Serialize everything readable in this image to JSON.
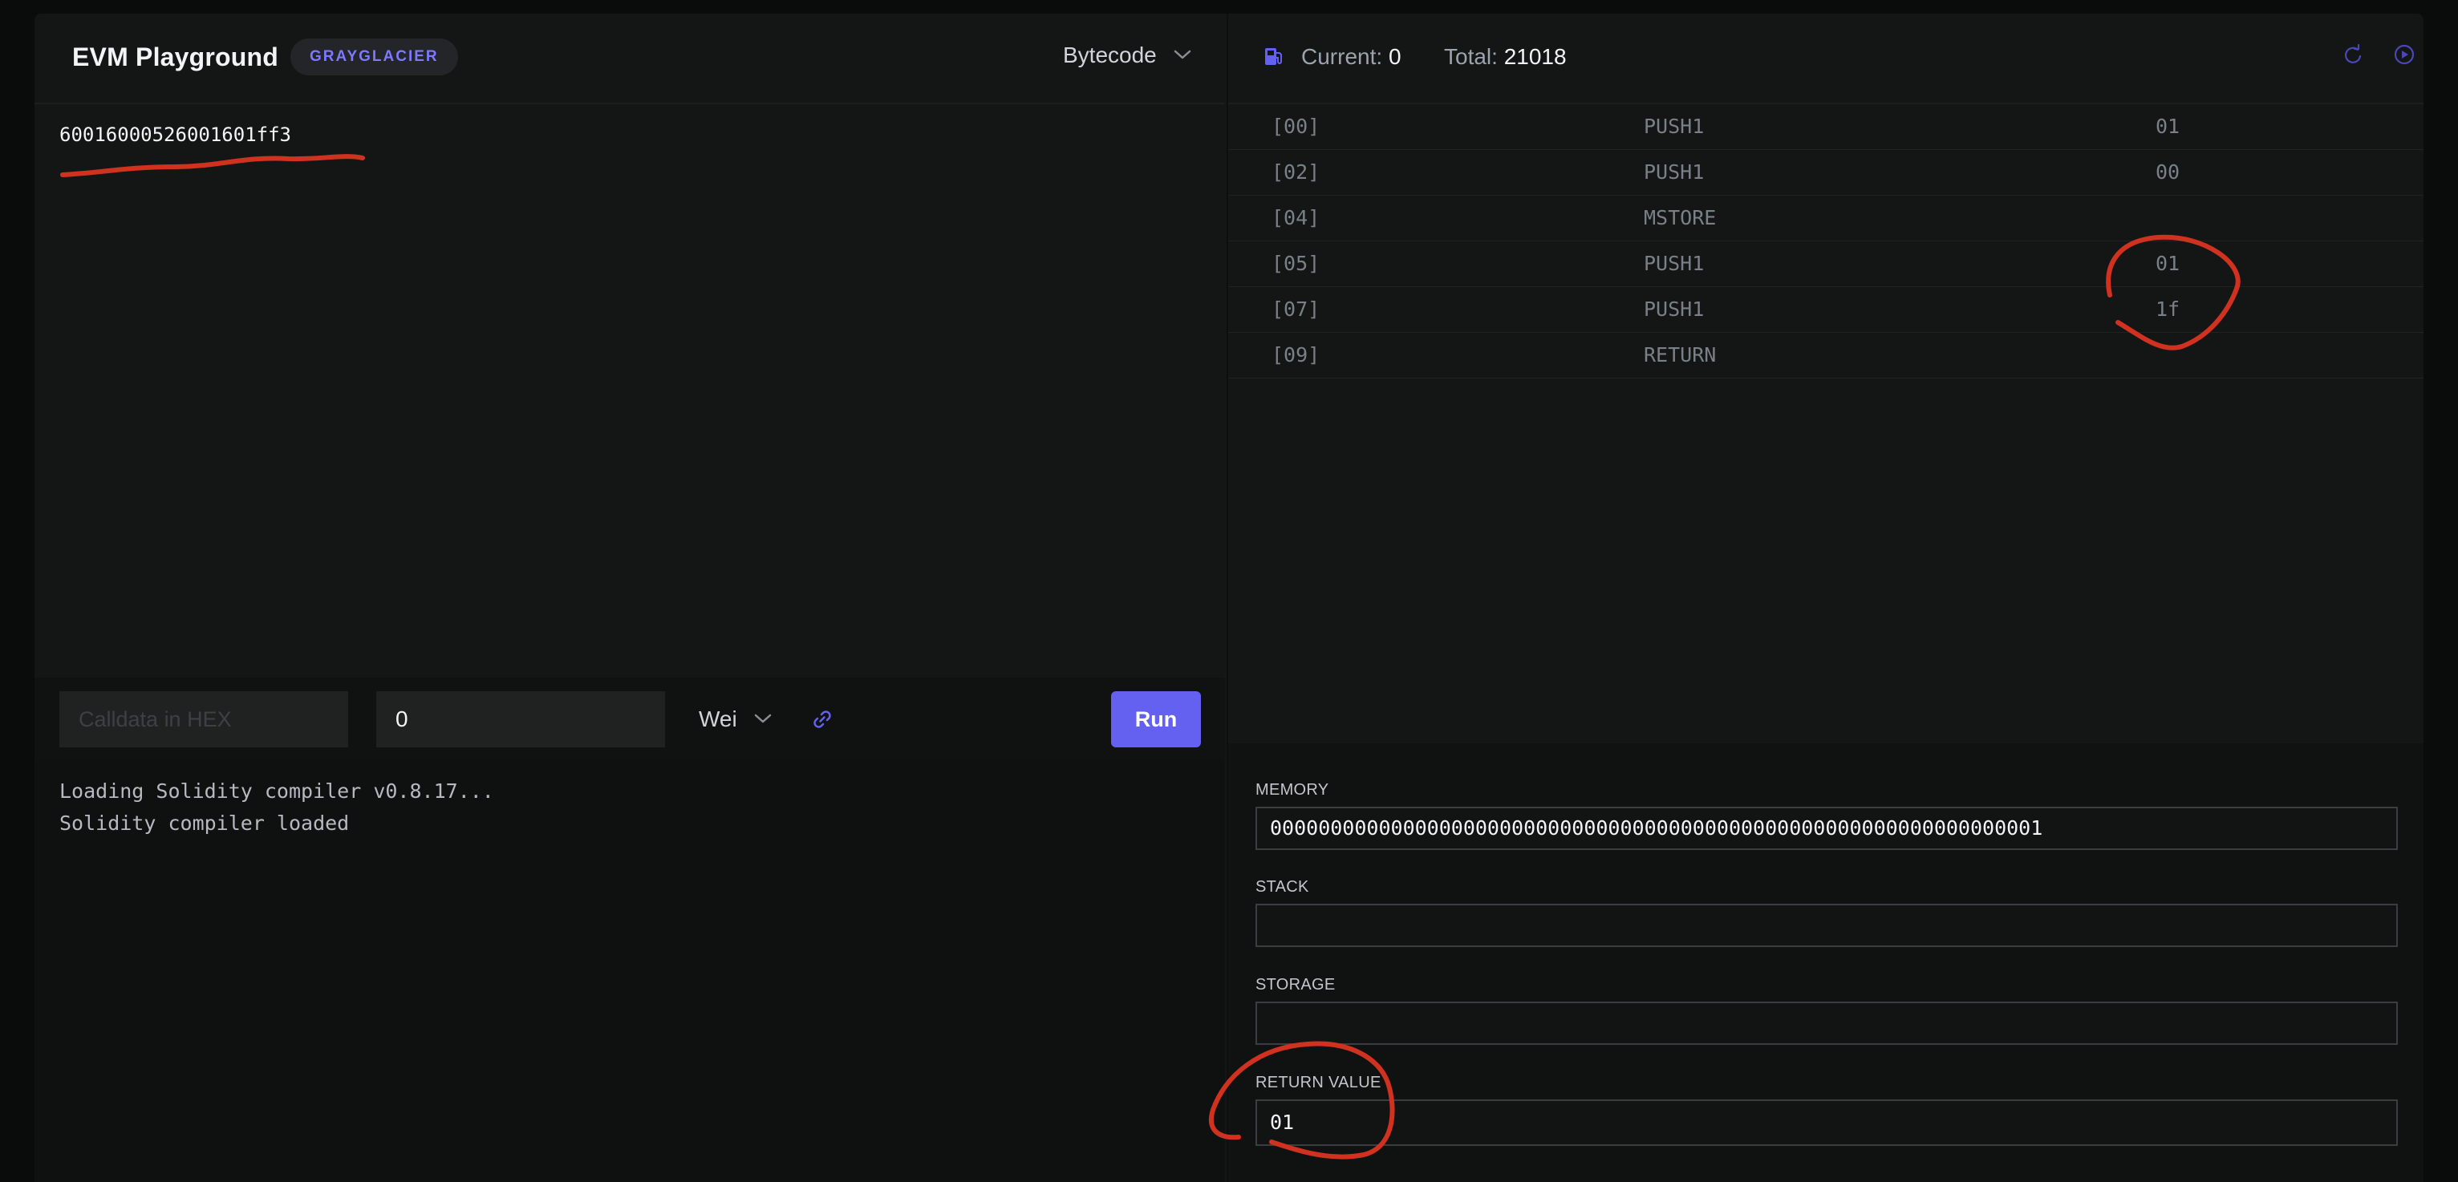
{
  "header": {
    "title": "EVM Playground",
    "fork_badge": "GRAYGLACIER",
    "mode_select": "Bytecode"
  },
  "editor": {
    "code": "60016000526001601ff3"
  },
  "toolbar": {
    "calldata_placeholder": "Calldata in HEX",
    "value": "0",
    "unit": "Wei",
    "run_label": "Run"
  },
  "console": {
    "lines": [
      "Loading Solidity compiler v0.8.17...",
      "Solidity compiler loaded"
    ]
  },
  "gas": {
    "current_label": "Current:",
    "current_value": "0",
    "total_label": "Total:",
    "total_value": "21018"
  },
  "icons": {
    "gas": "gas-pump-icon",
    "reset": "reset-icon",
    "step": "play-step-icon",
    "link": "link-icon",
    "chevron": "chevron-down-icon"
  },
  "opcodes": [
    {
      "pc": "[00]",
      "name": "PUSH1",
      "value": "01"
    },
    {
      "pc": "[02]",
      "name": "PUSH1",
      "value": "00"
    },
    {
      "pc": "[04]",
      "name": "MSTORE",
      "value": ""
    },
    {
      "pc": "[05]",
      "name": "PUSH1",
      "value": "01"
    },
    {
      "pc": "[07]",
      "name": "PUSH1",
      "value": "1f"
    },
    {
      "pc": "[09]",
      "name": "RETURN",
      "value": ""
    }
  ],
  "state": {
    "memory_label": "MEMORY",
    "memory_value": "0000000000000000000000000000000000000000000000000000000000000001",
    "stack_label": "STACK",
    "stack_value": "",
    "storage_label": "STORAGE",
    "storage_value": "",
    "return_label": "RETURN VALUE",
    "return_value": "01"
  },
  "colors": {
    "accent": "#6461f0",
    "annotation": "#d0321f",
    "background": "#141616"
  }
}
